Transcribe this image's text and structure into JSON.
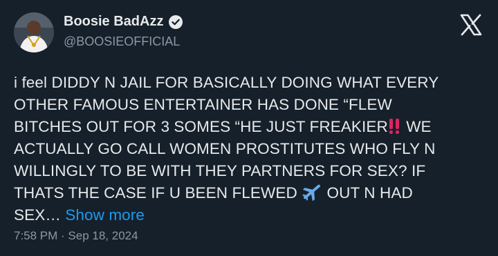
{
  "author": {
    "display_name": "Boosie BadAzz",
    "handle": "@BOOSIEOFFICIAL",
    "verified_icon": "verified-badge-icon"
  },
  "platform_icon": "x-logo-icon",
  "tweet": {
    "lines": [
      "i feel DIDDY N JAIL FOR BASICALLY DOING WHAT EVERY",
      "OTHER FAMOUS ENTERTAINER HAS DONE “FLEW",
      "BITCHES OUT FOR 3 SOMES “HE JUST FREAKIER",
      "WE",
      "ACTUALLY GO CALL WOMEN  PROSTITUTES WHO FLY N",
      "WILLINGLY TO BE WITH THEY PARTNERS FOR SEX? IF",
      "THATS THE CASE IF U BEEN FLEWED",
      "OUT N HAD",
      "SEX…"
    ],
    "show_more": "Show more",
    "emoji": [
      "double-exclamation-icon",
      "airplane-icon"
    ]
  },
  "timestamp": "7:58 PM · Sep 18, 2024",
  "colors": {
    "background": "#15202b",
    "text": "#e7e9ea",
    "secondary": "#8b98a5",
    "link": "#1d9bf0",
    "emoji_red": "#e0245e",
    "emoji_blue": "#6aa9e9"
  }
}
